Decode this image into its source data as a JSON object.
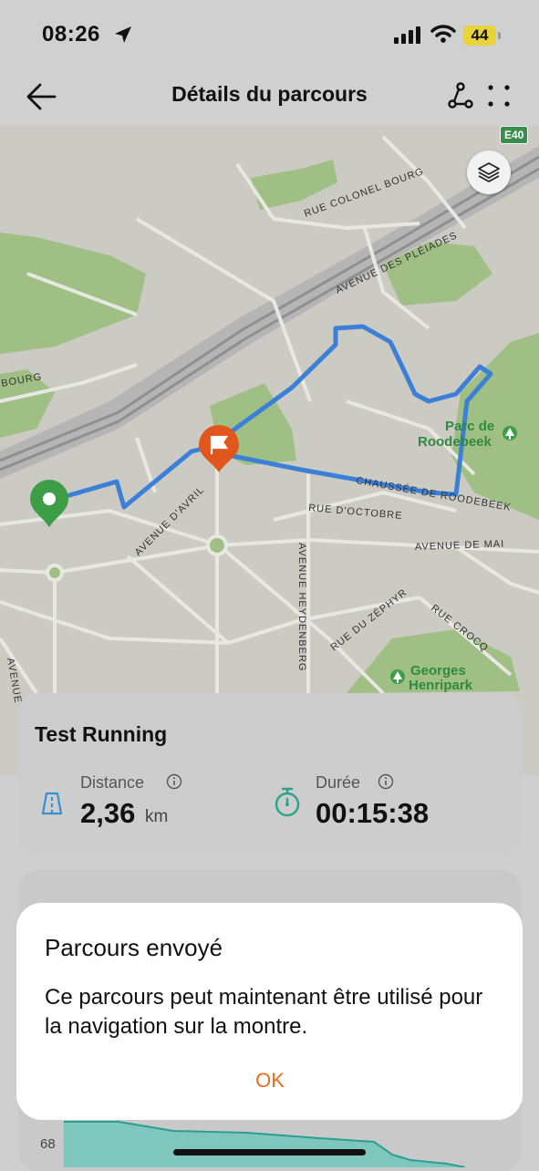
{
  "status_bar": {
    "time": "08:26",
    "battery": "44"
  },
  "header": {
    "title": "Détails du parcours"
  },
  "map": {
    "labels": {
      "rue_colonel_bourg": "RUE COLONEL BOURG",
      "avenue_pleiades": "AVENUE DES PLÉIADES",
      "bourg": "BOURG",
      "parc_roodebeek_1": "Parc de",
      "parc_roodebeek_2": "Roodebeek",
      "chaussee_roodebeek": "CHAUSSÉE DE ROODEBEEK",
      "rue_octobre": "RUE D'OCTOBRE",
      "avenue_avril": "AVENUE D'AVRIL",
      "avenue_mai": "AVENUE DE MAI",
      "avenue_heydenberg": "AVENUE HEYDENBERG",
      "rue_zephyr": "RUE DU ZÉPHYR",
      "rue_crocq": "RUE CROCQ",
      "georges_henripark_1": "Georges",
      "georges_henripark_2": "Henripark",
      "avenue_left": "AVENUE",
      "e40": "E40"
    },
    "route_color": "#3b7fd6",
    "start_color": "#3e9d47",
    "flag_color": "#e0561c"
  },
  "summary": {
    "activity_name": "Test Running",
    "distance_label": "Distance",
    "distance_value": "2,36",
    "distance_unit": "km",
    "duration_label": "Durée",
    "duration_value": "00:15:38"
  },
  "chart_partial": {
    "y_tick": "68"
  },
  "dialog": {
    "title": "Parcours envoyé",
    "body": "Ce parcours peut maintenant être utilisé pour la navigation sur la montre.",
    "ok_label": "OK"
  },
  "colors": {
    "accent": "#f06a1e",
    "teal": "#2aa58a",
    "distance_icon": "#3a8fd0"
  }
}
